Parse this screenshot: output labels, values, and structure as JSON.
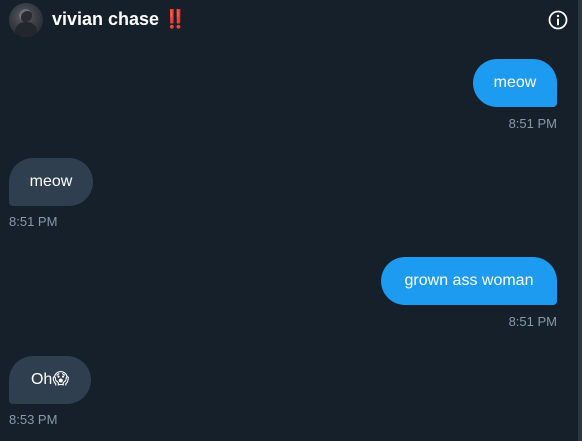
{
  "header": {
    "name": "vivian chase ‼️",
    "info_icon": "info-icon"
  },
  "messages": [
    {
      "direction": "outgoing",
      "text": "meow",
      "time": "8:51 PM"
    },
    {
      "direction": "incoming",
      "text": "meow",
      "time": "8:51 PM"
    },
    {
      "direction": "outgoing",
      "text": "grown ass woman",
      "time": "8:51 PM"
    },
    {
      "direction": "incoming",
      "text": "Oh😱",
      "time": "8:53 PM"
    }
  ],
  "colors": {
    "background": "#15202b",
    "outgoing_bubble": "#1d9bf0",
    "incoming_bubble": "#2f3f50",
    "timestamp": "#8b98a5"
  }
}
